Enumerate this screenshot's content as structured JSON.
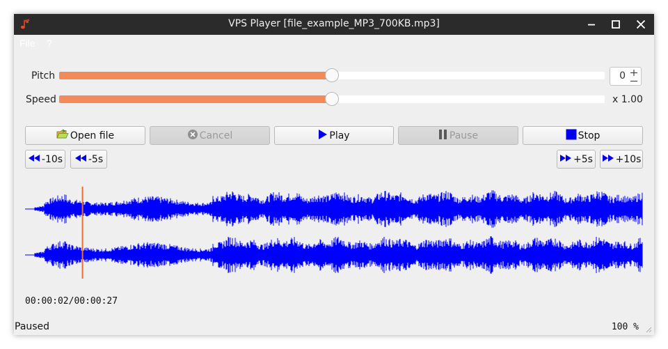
{
  "window": {
    "title": "VPS Player [file_example_MP3_700KB.mp3]",
    "icon": "music-note-icon",
    "controls": [
      "minimize-icon",
      "maximize-icon",
      "close-icon"
    ]
  },
  "menu": {
    "items": [
      "File",
      "?"
    ]
  },
  "pitch": {
    "label": "Pitch",
    "value": "0",
    "slider_level": 0.5
  },
  "speed": {
    "label": "Speed",
    "readout": "x 1.00",
    "slider_level": 0.5
  },
  "buttons": {
    "open_file": "Open file",
    "cancel": "Cancel",
    "play": "Play",
    "pause": "Pause",
    "stop": "Stop",
    "back10": "-10s",
    "back5": "-5s",
    "fwd5": "+5s",
    "fwd10": "+10s"
  },
  "playback": {
    "time": "00:00:02/00:00:27",
    "position_fraction": 0.093
  },
  "status": {
    "state": "Paused",
    "zoom": "100 %"
  },
  "colors": {
    "accent": "#f28a5a",
    "waveform": "#0000ff",
    "playhead": "#f06a30",
    "titlebar": "#2b2b2b"
  }
}
